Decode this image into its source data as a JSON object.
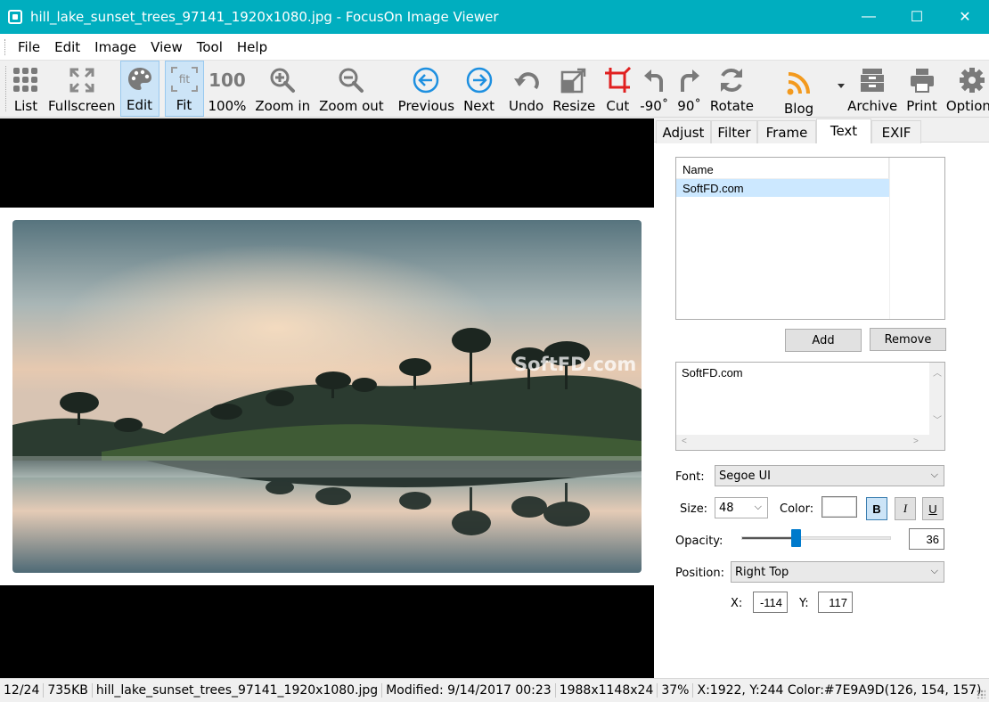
{
  "window": {
    "title": "hill_lake_sunset_trees_97141_1920x1080.jpg - FocusOn Image Viewer",
    "minimize": "—",
    "maximize": "☐",
    "close": "✕"
  },
  "menu": [
    "File",
    "Edit",
    "Image",
    "View",
    "Tool",
    "Help"
  ],
  "toolbar": {
    "list": "List",
    "fullscreen": "Fullscreen",
    "edit": "Edit",
    "fit": "Fit",
    "hundred_icon": "100",
    "hundred": "100%",
    "zoom_in": "Zoom in",
    "zoom_out": "Zoom out",
    "previous": "Previous",
    "next": "Next",
    "undo": "Undo",
    "resize": "Resize",
    "cut": "Cut",
    "rot_left": "-90˚",
    "rot_right": "90˚",
    "rotate": "Rotate",
    "blog": "Blog",
    "archive": "Archive",
    "print": "Print",
    "options": "Options"
  },
  "photo": {
    "watermark": "SoftFD.com"
  },
  "panel": {
    "tabs": [
      "Adjust",
      "Filter",
      "Frame",
      "Text",
      "EXIF"
    ],
    "selected_tab": "Text",
    "list_header": "Name",
    "list_items": [
      "SoftFD.com"
    ],
    "add_button": "Add",
    "remove_button": "Remove",
    "text_value": "SoftFD.com",
    "font_label": "Font:",
    "font_value": "Segoe UI",
    "size_label": "Size:",
    "size_value": "48",
    "color_label": "Color:",
    "bold": "B",
    "italic": "I",
    "underline": "U",
    "opacity_label": "Opacity:",
    "opacity_value": "36",
    "position_label": "Position:",
    "position_value": "Right Top",
    "x_label": "X:",
    "x_value": "-114",
    "y_label": "Y:",
    "y_value": "117"
  },
  "status": {
    "index": "12/24",
    "size": "735KB",
    "filename": "hill_lake_sunset_trees_97141_1920x1080.jpg",
    "modified": "Modified: 9/14/2017 00:23",
    "dimensions": "1988x1148x24",
    "zoom": "37%",
    "pixel": "X:1922, Y:244 Color:#7E9A9D(126, 154, 157)"
  },
  "colors": {
    "titlebar": "#00aebf",
    "selection": "#cce8ff",
    "slider_thumb": "#007acc"
  }
}
